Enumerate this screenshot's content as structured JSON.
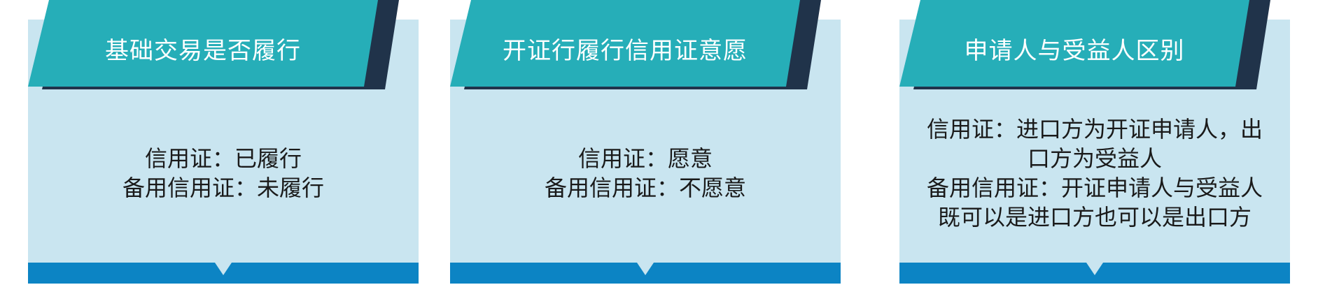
{
  "cards": [
    {
      "title": "基础交易是否履行",
      "lines": [
        "信用证：已履行",
        "备用信用证：未履行"
      ]
    },
    {
      "title": "开证行履行信用证意愿",
      "lines": [
        "信用证：愿意",
        "备用信用证：不愿意"
      ]
    },
    {
      "title": "申请人与受益人区别",
      "lines": [
        "信用证：进口方为开证申请人，出",
        "口方为受益人",
        "备用信用证：开证申请人与受益人",
        "既可以是进口方也可以是出口方"
      ]
    }
  ],
  "colors": {
    "title_bg": "#26aeb8",
    "title_shadow": "#20334a",
    "body_bg": "#c9e5f0",
    "footer_bg": "#0c84c4",
    "body_text": "#1a1a1a"
  }
}
